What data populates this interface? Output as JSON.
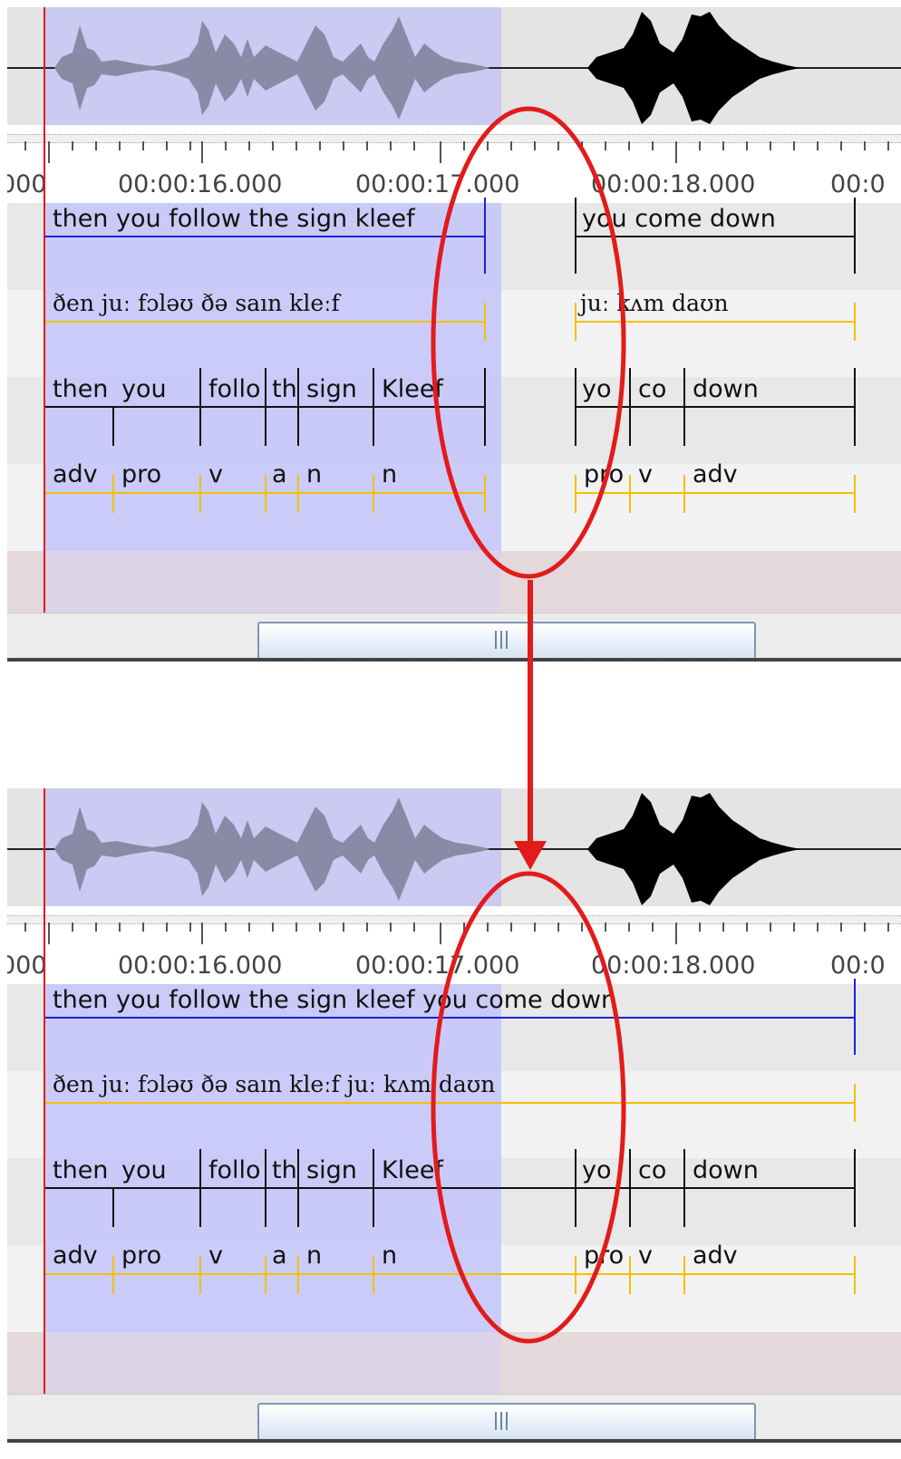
{
  "timeline": {
    "ticks": [
      "000",
      "00:00:16.000",
      "00:00:17.000",
      "00:00:18.000",
      "00:0"
    ]
  },
  "panels": [
    {
      "id": "before",
      "tier1": [
        {
          "text": "then you follow the sign kleef"
        },
        {
          "text": "you come down"
        }
      ],
      "tier2": [
        {
          "text": "ðen juː fɔləʊ ðə saın kleːf"
        },
        {
          "text": "juː kʌm daʊn"
        }
      ],
      "tier3": [
        "then",
        "you",
        "follo",
        "th",
        "sign",
        "Kleef",
        "yo",
        "co",
        "down"
      ],
      "tier4": [
        "adv",
        "pro",
        "v",
        "a",
        "n",
        "n",
        "pro",
        "v",
        "adv"
      ]
    },
    {
      "id": "after",
      "tier1": [
        {
          "text": "then you follow the sign kleef you come down"
        }
      ],
      "tier2": [
        {
          "text": "ðen juː fɔləʊ ðə saın kleːf juː kʌm daʊn"
        }
      ],
      "tier3": [
        "then",
        "you",
        "follo",
        "th",
        "sign",
        "Kleef",
        "yo",
        "co",
        "down"
      ],
      "tier4": [
        "adv",
        "pro",
        "v",
        "a",
        "n",
        "n",
        "pro",
        "v",
        "adv"
      ]
    }
  ],
  "scrollbar": {
    "grip_symbol": "|||"
  },
  "colors": {
    "selection": "#c8c8fa",
    "cursor": "#e21b1b",
    "annotation_blue": "#1a22d6",
    "annotation_gold": "#f3c000",
    "highlight_red": "#e21b1b"
  }
}
